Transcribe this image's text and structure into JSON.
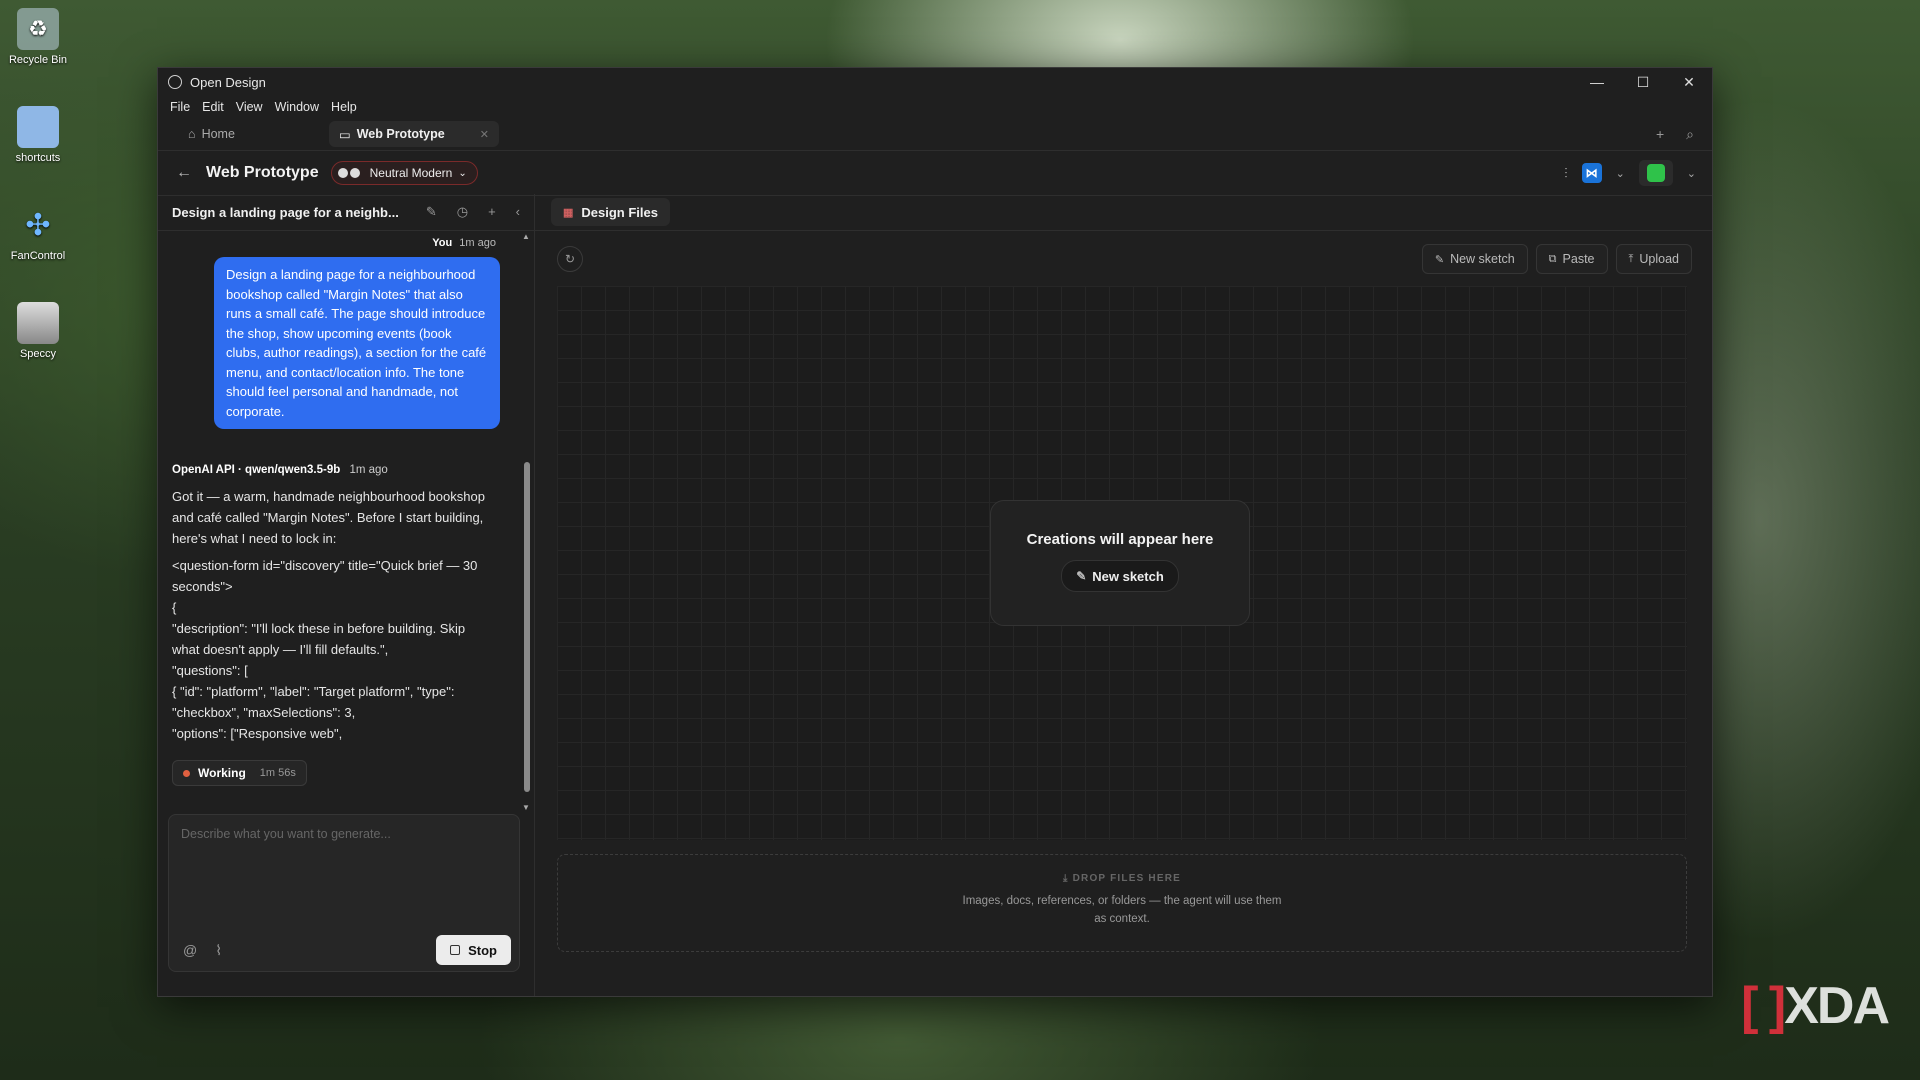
{
  "desktop": {
    "icons": [
      {
        "label": "Recycle Bin",
        "icon": "recycle-bin-icon"
      },
      {
        "label": "shortcuts",
        "icon": "folder-icon"
      },
      {
        "label": "FanControl",
        "icon": "fan-icon"
      },
      {
        "label": "Speccy",
        "icon": "speccy-icon"
      }
    ],
    "watermark": {
      "bracket": "[ ]",
      "text": "XDA"
    }
  },
  "window": {
    "title": "Open Design",
    "controls": {
      "minimize": "—",
      "maximize": "☐",
      "close": "✕"
    }
  },
  "menu": [
    "File",
    "Edit",
    "View",
    "Window",
    "Help"
  ],
  "tabs": [
    {
      "label": "Home",
      "icon": "home-icon",
      "active": false
    },
    {
      "label": "Web Prototype",
      "icon": "folder-icon",
      "active": true
    }
  ],
  "project": {
    "title": "Web Prototype",
    "style_selector": "Neutral Modern"
  },
  "conversation": {
    "title": "Design a landing page for a neighb...",
    "user_message": {
      "author": "You",
      "time": "1m ago",
      "text": "Design a landing page for a neighbourhood bookshop called \"Margin Notes\" that also runs a small café. The page should introduce the shop, show upcoming events (book clubs, author readings), a section for the café menu, and contact/location info. The tone should feel personal and handmade, not corporate."
    },
    "assistant_message": {
      "author": "OpenAI API · qwen/qwen3.5-9b",
      "time": "1m ago",
      "intro": "Got it — a warm, handmade neighbourhood bookshop and café called \"Margin Notes\". Before I start building, here's what I need to lock in:",
      "lines": [
        "<question-form id=\"discovery\" title=\"Quick brief — 30 seconds\">",
        "{",
        "\"description\": \"I'll lock these in before building. Skip what doesn't apply — I'll fill defaults.\",",
        "\"questions\": [",
        "{ \"id\": \"platform\", \"label\": \"Target platform\", \"type\": \"checkbox\", \"maxSelections\": 3,",
        "\"options\": [\"Responsive web\","
      ]
    },
    "status": {
      "label": "Working",
      "elapsed": "1m 56s"
    }
  },
  "composer": {
    "placeholder": "Describe what you want to generate...",
    "stop_label": "Stop"
  },
  "design_files": {
    "tab_label": "Design Files",
    "buttons": {
      "new_sketch": "New sketch",
      "paste": "Paste",
      "upload": "Upload"
    },
    "empty_title": "Creations will appear here",
    "empty_button": "New sketch",
    "drop_heading": "DROP FILES HERE",
    "drop_desc": "Images, docs, references, or folders — the agent will use them as context."
  }
}
